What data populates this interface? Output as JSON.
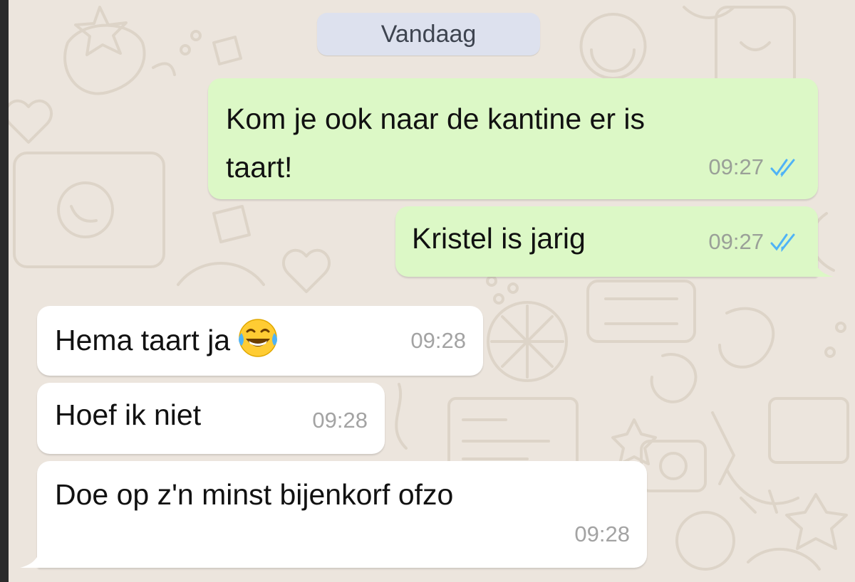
{
  "date_separator": "Vandaag",
  "messages": [
    {
      "direction": "outgoing",
      "lines": [
        "Kom je ook naar de kantine er is",
        "taart!"
      ],
      "time": "09:27",
      "read_status": "read-double-check"
    },
    {
      "direction": "outgoing",
      "text": "Kristel is jarig",
      "time": "09:27",
      "read_status": "read-double-check"
    },
    {
      "direction": "incoming",
      "text": "Hema taart ja",
      "emoji": "face-with-tears-of-joy",
      "time": "09:28"
    },
    {
      "direction": "incoming",
      "text": "Hoef ik niet",
      "time": "09:28"
    },
    {
      "direction": "incoming",
      "text": "Doe op z'n minst bijenkorf ofzo",
      "time": "09:28"
    }
  ],
  "colors": {
    "chat_background": "#ece5dd",
    "outgoing_bubble": "#dcf8c6",
    "incoming_bubble": "#ffffff",
    "read_ticks": "#4fb3f6",
    "date_pill": "#dde1ee"
  }
}
